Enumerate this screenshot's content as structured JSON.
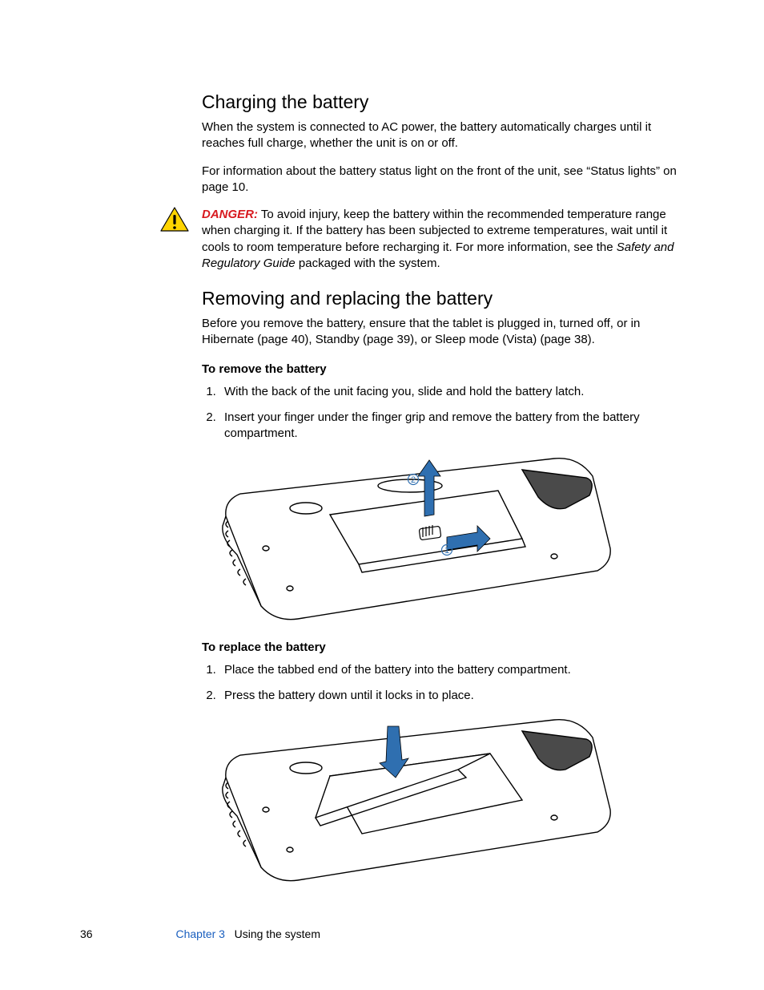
{
  "section1": {
    "title": "Charging the battery",
    "para1": "When the system is connected to AC power, the battery automatically charges until it reaches full charge, whether the unit is on or off.",
    "para2": "For information about the battery status light on the front of the unit, see “Status lights” on page 10."
  },
  "danger": {
    "label": "DANGER:",
    "text_before": " To avoid injury, keep the battery within the recommended temperature range when charging it. If the battery has been subjected to extreme temperatures, wait until it cools to room temperature before recharging it. For more information, see the ",
    "italic": "Safety and Regulatory Guide",
    "text_after": " packaged with the system."
  },
  "section2": {
    "title": "Removing and replacing the battery",
    "intro": "Before you remove the battery, ensure that the tablet is plugged in, turned off, or in Hibernate (page 40), Standby (page 39), or Sleep mode (Vista) (page 38)."
  },
  "remove": {
    "subhead": "To remove the battery",
    "step1": "With the back of the unit facing you, slide and hold the battery latch.",
    "step2": "Insert your finger under the finger grip and remove the battery from the battery compartment."
  },
  "replace": {
    "subhead": "To replace the battery",
    "step1": "Place the tabbed end of the battery into the battery compartment.",
    "step2": "Press the battery down until it locks in to place."
  },
  "figure_labels": {
    "one": "1",
    "two": "2"
  },
  "footer": {
    "pagenum": "36",
    "chapter": "Chapter 3",
    "title": "Using the system"
  }
}
